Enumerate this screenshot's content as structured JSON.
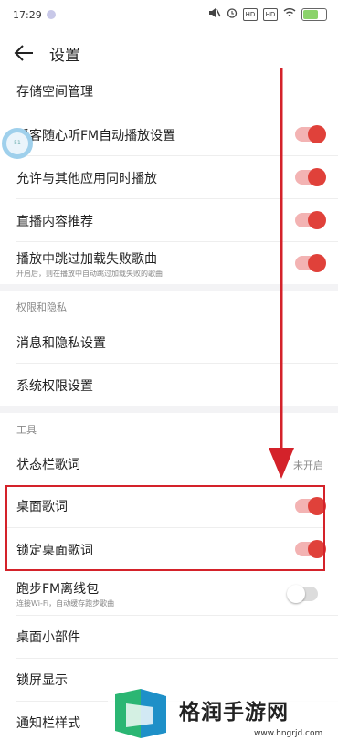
{
  "status_bar": {
    "time": "17:29",
    "battery": "58"
  },
  "header": {
    "title": "设置"
  },
  "settings": {
    "storage": "存储空间管理",
    "podcast_autoplay": "播客随心听FM自动播放设置",
    "mix_play": "允许与其他应用同时播放",
    "live_recommend": "直播内容推荐",
    "skip_failed": "播放中跳过加载失败歌曲",
    "skip_failed_desc": "开启后，则在播放中自动跳过加载失败的歌曲"
  },
  "privacy": {
    "section_title": "权限和隐私",
    "msg_privacy": "消息和隐私设置",
    "sys_permission": "系统权限设置"
  },
  "tools": {
    "section_title": "工具",
    "statusbar_lyrics": "状态栏歌词",
    "statusbar_lyrics_value": "未开启",
    "desktop_lyrics": "桌面歌词",
    "lock_desktop_lyrics": "锁定桌面歌词",
    "running_fm": "跑步FM离线包",
    "running_fm_desc": "连接Wi-Fi，自动缓存跑步歌曲",
    "desktop_widget": "桌面小部件",
    "lock_screen": "锁屏显示",
    "notify_style": "通知栏样式"
  },
  "toggles": {
    "podcast_autoplay": true,
    "mix_play": true,
    "live_recommend": true,
    "skip_failed": true,
    "desktop_lyrics": true,
    "lock_desktop_lyrics": true,
    "running_fm": false
  },
  "watermark": {
    "text": "格润手游网",
    "url": "www.hngrjd.com"
  },
  "colors": {
    "accent": "#e0413a",
    "annotation": "#d4222a"
  }
}
